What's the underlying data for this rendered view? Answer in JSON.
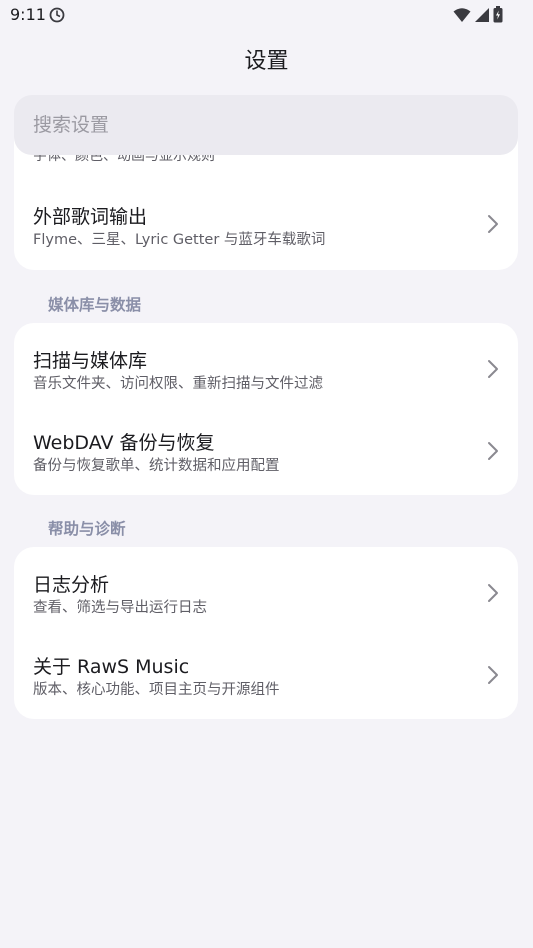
{
  "status_bar": {
    "time": "9:11",
    "icons": [
      "sync-icon",
      "wifi-icon",
      "signal-icon",
      "battery-icon"
    ]
  },
  "header": {
    "title": "设置"
  },
  "search": {
    "placeholder": "搜索设置"
  },
  "top_card": {
    "cut_item_subtitle": "字体、颜色、动画与显示规则",
    "items": [
      {
        "title": "外部歌词输出",
        "subtitle": "Flyme、三星、Lyric Getter 与蓝牙车载歌词"
      }
    ]
  },
  "sections": [
    {
      "header": "媒体库与数据",
      "items": [
        {
          "title": "扫描与媒体库",
          "subtitle": "音乐文件夹、访问权限、重新扫描与文件过滤"
        },
        {
          "title": "WebDAV 备份与恢复",
          "subtitle": "备份与恢复歌单、统计数据和应用配置"
        }
      ]
    },
    {
      "header": "帮助与诊断",
      "items": [
        {
          "title": "日志分析",
          "subtitle": "查看、筛选与导出运行日志"
        },
        {
          "title": "关于 RawS Music",
          "subtitle": "版本、核心功能、项目主页与开源组件"
        }
      ]
    }
  ],
  "colors": {
    "background": "#f4f3f8",
    "card": "#ffffff",
    "section_header": "#8a8fa8",
    "search_bg": "#ebeaf0"
  }
}
